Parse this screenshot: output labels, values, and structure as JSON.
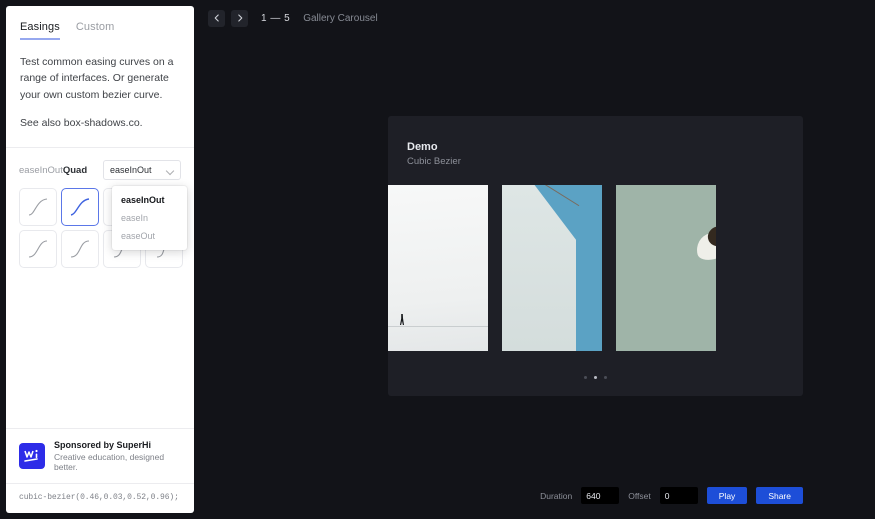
{
  "sidebar": {
    "tabs": [
      {
        "label": "Easings",
        "active": true
      },
      {
        "label": "Custom",
        "active": false
      }
    ],
    "description_1": "Test common easing curves on a range of interfaces. Or generate your own custom bezier curve.",
    "description_2": "See also box-shadows.co.",
    "easing": {
      "label_prefix": "easeInOut",
      "label_suffix": "Quad",
      "select_value": "easeInOut",
      "options": [
        "easeInOut",
        "easeIn",
        "easeOut"
      ],
      "selected_option": "easeInOut"
    },
    "sponsor": {
      "title": "Sponsored by SuperHi",
      "subtitle": "Creative education, designed better.",
      "logo_icon": "superhi-logo-icon"
    },
    "code": "cubic-bezier(0.46,0.03,0.52,0.96);"
  },
  "topbar": {
    "prev_icon": "chevron-left-icon",
    "next_icon": "chevron-right-icon",
    "counter": "1 — 5",
    "title": "Gallery Carousel"
  },
  "demo": {
    "title": "Demo",
    "subtitle": "Cubic Bezier",
    "slides": [
      {
        "name": "snow-walker-photo"
      },
      {
        "name": "blue-sky-building-photo"
      },
      {
        "name": "green-wall-lamp-photo"
      }
    ],
    "dots": [
      {
        "active": false
      },
      {
        "active": true
      },
      {
        "active": false
      }
    ]
  },
  "controls": {
    "duration_label": "Duration",
    "duration_value": "640",
    "offset_label": "Offset",
    "offset_value": "0",
    "play_label": "Play",
    "share_label": "Share"
  },
  "colors": {
    "accent_blue": "#1d4ed8",
    "select_blue": "#5b77e8",
    "background": "#121318",
    "card": "#1e1f26"
  }
}
